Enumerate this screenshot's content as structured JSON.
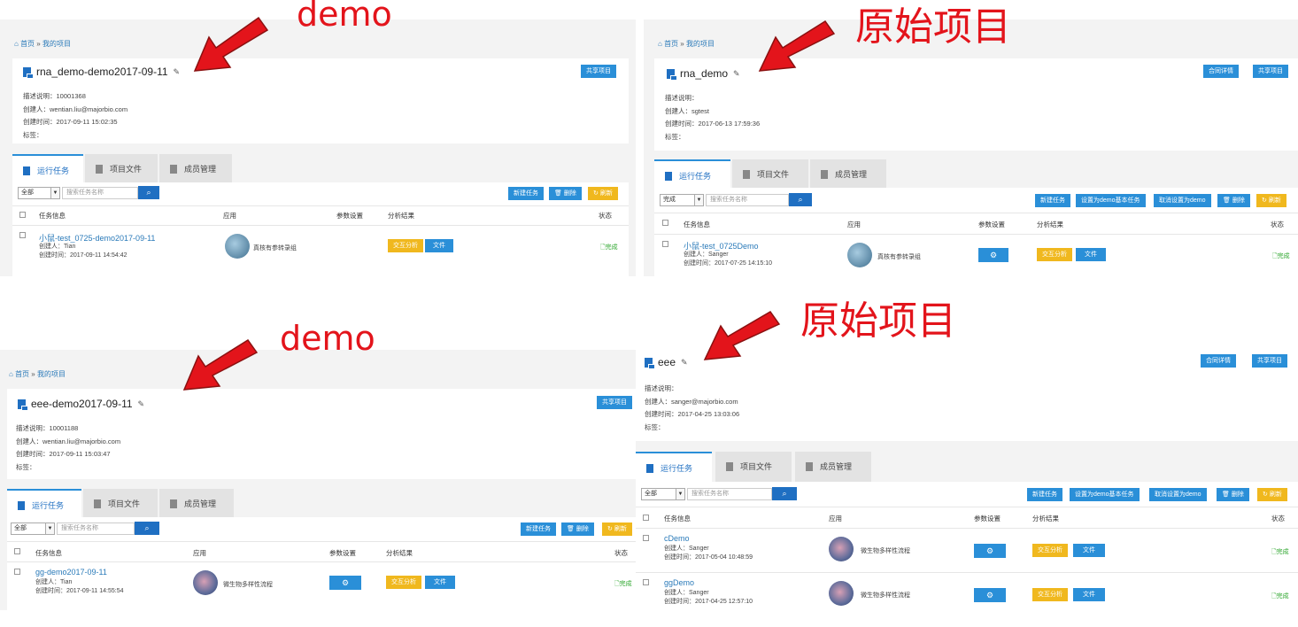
{
  "annotations": {
    "demo": "demo",
    "original": "原始项目"
  },
  "breadcrumb": {
    "home": "首页",
    "sep": "»",
    "current": "我的项目"
  },
  "common": {
    "share": "共享项目",
    "contract": "合同详情",
    "new_task": "新建任务",
    "set_demo": "设置为demo基本任务",
    "unset_demo": "取消设置为demo",
    "delete": "删除",
    "refresh": "刷新",
    "search_placeholder": "搜索任务名称",
    "interactive": "交互分析",
    "file": "文件",
    "tabs": [
      "运行任务",
      "项目文件",
      "成员管理"
    ],
    "columns": [
      "任务信息",
      "应用",
      "参数设置",
      "分析结果",
      "状态"
    ],
    "done": "完成"
  },
  "panel1": {
    "title": "rna_demo-demo2017-09-11",
    "info": [
      "描述说明：10001368",
      "创建人：wentian.liu@majorbio.com",
      "创建时间：2017-09-11 15:02:35",
      "标签："
    ],
    "filter": "全部",
    "rows": [
      {
        "name": "小鼠-test_0725-demo2017-09-11",
        "creator": "创建人：Tian",
        "time": "创建时间：2017-09-11 14:54:42",
        "app": "真核有参转录组"
      }
    ]
  },
  "panel2": {
    "title": "rna_demo",
    "info": [
      "描述说明：",
      "创建人：sgtest",
      "创建时间：2017-06-13 17:59:36",
      "标签："
    ],
    "filter": "完成",
    "rows": [
      {
        "name": "小鼠-test_0725Demo",
        "creator": "创建人：Sanger",
        "time": "创建时间：2017-07-25 14:15:10",
        "app": "真核有参转录组"
      }
    ]
  },
  "panel3": {
    "title": "eee-demo2017-09-11",
    "info": [
      "描述说明：10001188",
      "创建人：wentian.liu@majorbio.com",
      "创建时间：2017-09-11 15:03:47",
      "标签："
    ],
    "filter": "全部",
    "rows": [
      {
        "name": "gg-demo2017-09-11",
        "creator": "创建人：Tian",
        "time": "创建时间：2017-09-11 14:55:54",
        "app": "微生物多样性流程"
      }
    ]
  },
  "panel4": {
    "title": "eee",
    "info": [
      "描述说明：",
      "创建人：sanger@majorbio.com",
      "创建时间：2017-04-25 13:03:06",
      "标签："
    ],
    "filter": "全部",
    "rows": [
      {
        "name": "cDemo",
        "creator": "创建人：Sanger",
        "time": "创建时间：2017-05-04 10:48:59",
        "app": "微生物多样性流程"
      },
      {
        "name": "ggDemo",
        "creator": "创建人：Sanger",
        "time": "创建时间：2017-04-25 12:57:10",
        "app": "微生物多样性流程"
      }
    ]
  }
}
